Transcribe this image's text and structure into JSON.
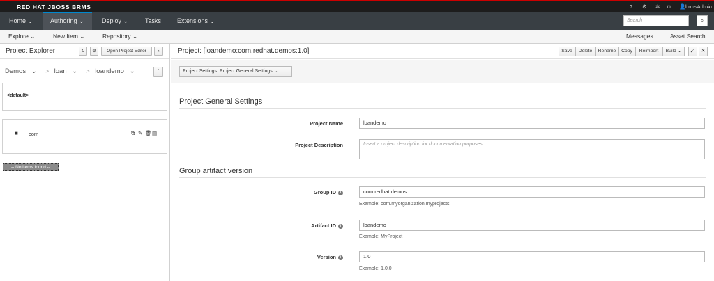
{
  "brand": "RED HAT JBOSS BRMS",
  "utility": {
    "help": "?",
    "user": "brmsAdmin"
  },
  "nav": {
    "items": [
      "Home",
      "Authoring",
      "Deploy",
      "Tasks",
      "Extensions"
    ],
    "search_placeholder": "Search"
  },
  "subnav": {
    "explore": "Explore",
    "new_item": "New Item",
    "repository": "Repository",
    "messages": "Messages",
    "asset_search": "Asset Search"
  },
  "explorer": {
    "title": "Project Explorer",
    "open_editor": "Open Project Editor",
    "breadcrumbs": [
      "Demos",
      "loan",
      "loandemo"
    ],
    "default_package": "<default>",
    "folder": "com",
    "no_items": "-- No items found --"
  },
  "project": {
    "title": "Project: [loandemo:com.redhat.demos:1.0]",
    "toolbar": [
      "Save",
      "Delete",
      "Rename",
      "Copy",
      "Reimport",
      "Build"
    ],
    "settings_dropdown": "Project Settings: Project General Settings",
    "general_heading": "Project General Settings",
    "name_label": "Project Name",
    "name_value": "loandemo",
    "desc_label": "Project Description",
    "desc_placeholder": "Insert a project description for documentation purposes ...",
    "gav_heading": "Group artifact version",
    "group_label": "Group ID",
    "group_value": "com.redhat.demos",
    "group_help": "Example: com.myorganization.myprojects",
    "artifact_label": "Artifact ID",
    "artifact_value": "loandemo",
    "artifact_help": "Example: MyProject",
    "version_label": "Version",
    "version_value": "1.0",
    "version_help": "Example: 1.0.0"
  }
}
